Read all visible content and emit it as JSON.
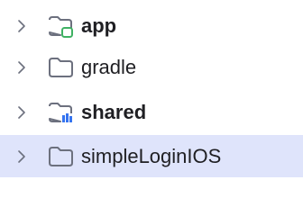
{
  "tree": {
    "items": [
      {
        "label": "app",
        "bold": true,
        "badge": "module-green",
        "selected": false,
        "expanded": false
      },
      {
        "label": "gradle",
        "bold": false,
        "badge": null,
        "selected": false,
        "expanded": false
      },
      {
        "label": "shared",
        "bold": true,
        "badge": "library-blue",
        "selected": false,
        "expanded": false
      },
      {
        "label": "simpleLoginIOS",
        "bold": false,
        "badge": null,
        "selected": true,
        "expanded": false
      }
    ]
  },
  "colors": {
    "text": "#1f1f23",
    "chevron": "#6c707e",
    "folder_outline": "#6c707e",
    "module_badge": "#3fb163",
    "library_badge": "#3574f0",
    "selection_bg": "#dfe4fb"
  },
  "icons": {
    "chevron": "chevron-right-icon",
    "folder": "folder-icon",
    "module_badge": "module-badge-icon",
    "library_badge": "library-badge-icon"
  }
}
